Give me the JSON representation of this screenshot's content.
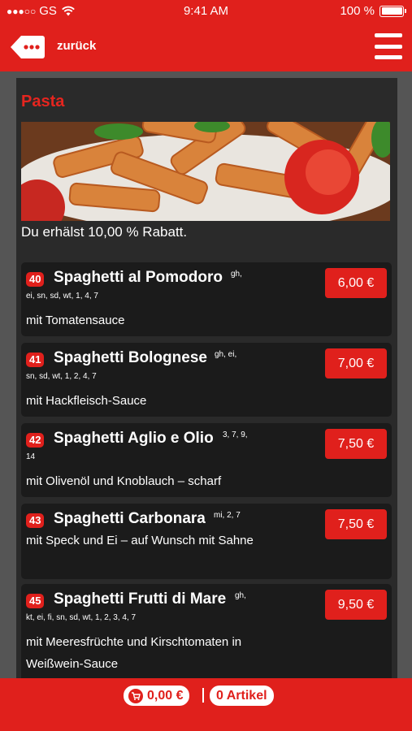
{
  "status": {
    "carrier": "GS",
    "time": "9:41 AM",
    "battery": "100 %"
  },
  "nav": {
    "back_label": "zurück"
  },
  "category": {
    "title": "Pasta",
    "discount": "Du erhälst 10,00 % Rabatt."
  },
  "items": [
    {
      "num": "40",
      "name": "Spaghetti al Pomodoro",
      "sup": "gh,",
      "allergens": "ei, sn, sd, wt, 1, 4, 7",
      "desc": "mit Tomatensauce",
      "price": "6,00 €"
    },
    {
      "num": "41",
      "name": "Spaghetti Bolognese",
      "sup": "gh, ei,",
      "allergens": "sn, sd, wt, 1, 2, 4, 7",
      "desc": "mit Hackfleisch-Sauce",
      "price": "7,00 €"
    },
    {
      "num": "42",
      "name": "Spaghetti Aglio e Olio",
      "sup": "3, 7, 9,",
      "allergens": "14",
      "desc": "mit Olivenöl und Knoblauch – scharf",
      "price": "7,50 €"
    },
    {
      "num": "43",
      "name": "Spaghetti Carbonara",
      "sup": "mi, 2, 7",
      "allergens": "",
      "desc": "mit Speck und Ei – auf Wunsch mit Sahne",
      "price": "7,50 €"
    },
    {
      "num": "45",
      "name": "Spaghetti Frutti di Mare",
      "sup": "gh,",
      "allergens": "kt, ei, fi, sn, sd, wt, 1, 2, 3, 4, 7",
      "desc": "mit Meeresfrüchte und Kirschtomaten in Weißwein-Sauce",
      "price": "9,50 €"
    }
  ],
  "cart": {
    "total": "0,00 €",
    "count": "0 Artikel"
  },
  "colors": {
    "accent": "#e0201c",
    "panel": "#2a2a2a",
    "card": "#1b1b1b"
  }
}
